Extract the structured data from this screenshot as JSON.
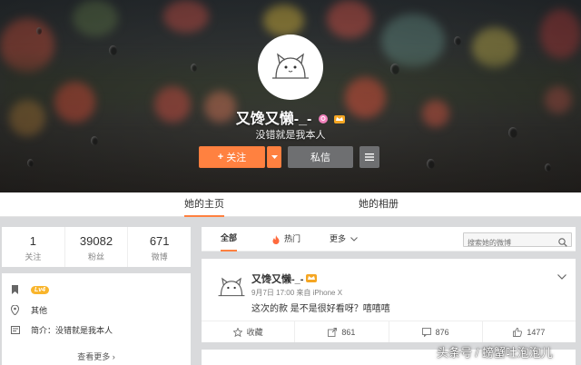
{
  "profile": {
    "name": "又馋又懒-_-",
    "bio": "没错就是我本人"
  },
  "actions": {
    "follow_label": "关注",
    "follow_plus": "+",
    "message_label": "私信"
  },
  "tabs": [
    {
      "label": "她的主页",
      "active": true
    },
    {
      "label": "她的相册",
      "active": false
    }
  ],
  "stats": [
    {
      "value": "1",
      "label": "关注"
    },
    {
      "value": "39082",
      "label": "粉丝"
    },
    {
      "value": "671",
      "label": "微博"
    }
  ],
  "info": {
    "level": "Lv4",
    "location": "其他",
    "intro": "简介：没错就是我本人",
    "more_label": "查看更多 ›"
  },
  "feed_filter": {
    "tabs": [
      {
        "label": "全部",
        "active": true
      },
      {
        "label": "热门",
        "active": false
      },
      {
        "label": "更多",
        "active": false
      }
    ],
    "search_placeholder": "搜索她的微博"
  },
  "post": {
    "author": "又馋又懒-_-",
    "meta": "9月7日 17:00 来自 iPhone X",
    "text": "这次的款 是不是很好看呀？嘻嘻嘻",
    "actions": [
      {
        "label": "收藏",
        "icon": "star-icon"
      },
      {
        "label": "861",
        "icon": "share-icon"
      },
      {
        "label": "876",
        "icon": "comment-icon"
      },
      {
        "label": "1477",
        "icon": "like-icon"
      }
    ]
  },
  "watermark": "头条号 / 螃蟹吐泡泡儿",
  "colors": {
    "accent": "#ff8140",
    "button_gray": "#6e6f71",
    "level_badge": "#f9b52c"
  }
}
